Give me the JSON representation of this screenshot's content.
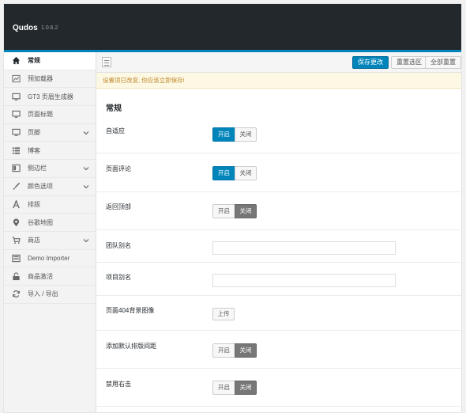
{
  "header": {
    "title": "Qudos",
    "version": "1.0.6.2"
  },
  "sidebar": {
    "items": [
      {
        "label": "常规",
        "icon": "home-icon"
      },
      {
        "label": "预加载器",
        "icon": "chart-icon"
      },
      {
        "label": "GT3 页眉生成器",
        "icon": "monitor-icon"
      },
      {
        "label": "页面标题",
        "icon": "monitor-icon"
      },
      {
        "label": "页脚",
        "icon": "monitor-icon"
      },
      {
        "label": "博客",
        "icon": "list-icon"
      },
      {
        "label": "侧边栏",
        "icon": "sidebar-icon"
      },
      {
        "label": "颜色选项",
        "icon": "brush-icon"
      },
      {
        "label": "排版",
        "icon": "typography-icon"
      },
      {
        "label": "谷歌地图",
        "icon": "map-pin-icon"
      },
      {
        "label": "商店",
        "icon": "cart-icon"
      },
      {
        "label": "Demo Importer",
        "icon": "import-icon"
      },
      {
        "label": "商品激活",
        "icon": "unlock-icon"
      },
      {
        "label": "导入 / 导出",
        "icon": "refresh-icon"
      }
    ]
  },
  "toolbar": {
    "save_label": "保存更改",
    "reset_section_label": "重置选区",
    "reset_all_label": "全部重置"
  },
  "notice": {
    "text": "设置项已改变, 你应该立即保存!"
  },
  "section": {
    "title": "常规"
  },
  "settings": {
    "responsive": {
      "label": "自适应",
      "on": "开启",
      "off": "关闭",
      "value": "on"
    },
    "page_comments": {
      "label": "页面评论",
      "on": "开启",
      "off": "关闭",
      "value": "on"
    },
    "back_to_top": {
      "label": "返回顶部",
      "on": "开启",
      "off": "关闭",
      "value": "off"
    },
    "team_slug": {
      "label": "团队别名",
      "value": ""
    },
    "project_slug": {
      "label": "项目别名",
      "value": ""
    },
    "page_404_bg": {
      "label": "页面404背景图像",
      "button": "上传"
    },
    "default_typography_spacing": {
      "label": "添加默认排版间距",
      "on": "开启",
      "off": "关闭",
      "value": "off"
    },
    "disable_right_click": {
      "label": "禁用右击",
      "on": "开启",
      "off": "关闭",
      "value": "off"
    }
  }
}
